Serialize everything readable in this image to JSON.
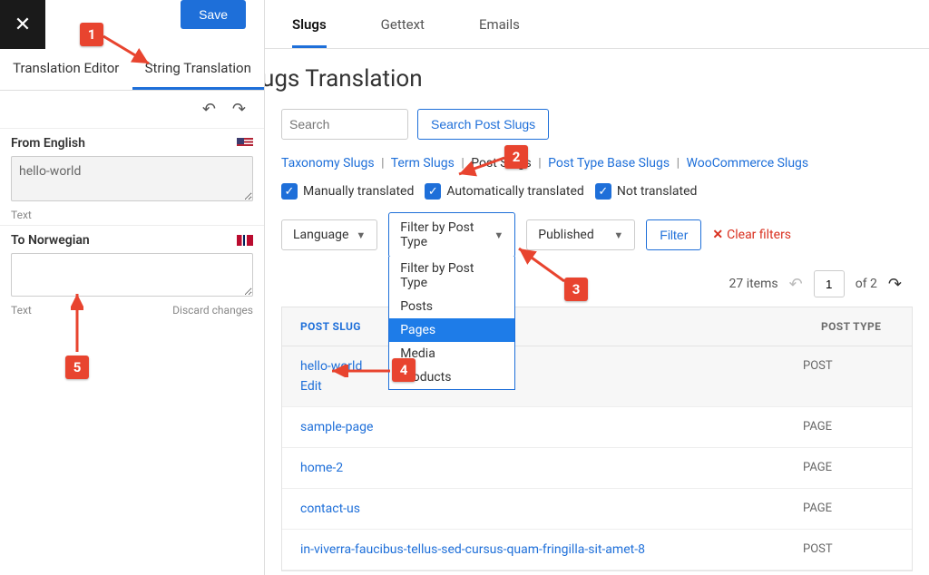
{
  "sidebar": {
    "close_icon": "✕",
    "save_label": "Save",
    "tabs": {
      "translation_editor": "Translation Editor",
      "string_translation": "String Translation"
    },
    "from_label": "From English",
    "from_value": "hello-world",
    "text_hint": "Text",
    "to_label": "To Norwegian",
    "to_value": "",
    "discard": "Discard changes"
  },
  "main": {
    "tabs": {
      "slugs": "Slugs",
      "gettext": "Gettext",
      "emails": "Emails"
    },
    "page_title": "ugs Translation",
    "search": {
      "placeholder": "Search",
      "button": "Search Post Slugs"
    },
    "slug_types": {
      "taxonomy": "Taxonomy Slugs",
      "term": "Term Slugs",
      "post": "Post Slugs",
      "post_type_base": "Post Type Base Slugs",
      "woo": "WooCommerce Slugs"
    },
    "checks": {
      "manual": "Manually translated",
      "auto": "Automatically translated",
      "not": "Not translated"
    },
    "selects": {
      "language": "Language",
      "filter_post_type": "Filter by Post Type",
      "published": "Published",
      "filter_btn": "Filter",
      "clear": "Clear filters"
    },
    "dropdown": {
      "header": "Filter by Post Type",
      "posts": "Posts",
      "pages": "Pages",
      "media": "Media",
      "products": "Products"
    },
    "pagination": {
      "items": "27 items",
      "page": "1",
      "of": "of 2"
    },
    "table": {
      "th_slug": "POST SLUG",
      "th_type": "POST TYPE",
      "edit": "Edit",
      "rows": [
        {
          "slug": "hello-world",
          "type": "POST"
        },
        {
          "slug": "sample-page",
          "type": "PAGE"
        },
        {
          "slug": "home-2",
          "type": "PAGE"
        },
        {
          "slug": "contact-us",
          "type": "PAGE"
        },
        {
          "slug": "in-viverra-faucibus-tellus-sed-cursus-quam-fringilla-sit-amet-8",
          "type": "POST"
        }
      ]
    }
  },
  "callouts": {
    "c1": "1",
    "c2": "2",
    "c3": "3",
    "c4": "4",
    "c5": "5"
  }
}
